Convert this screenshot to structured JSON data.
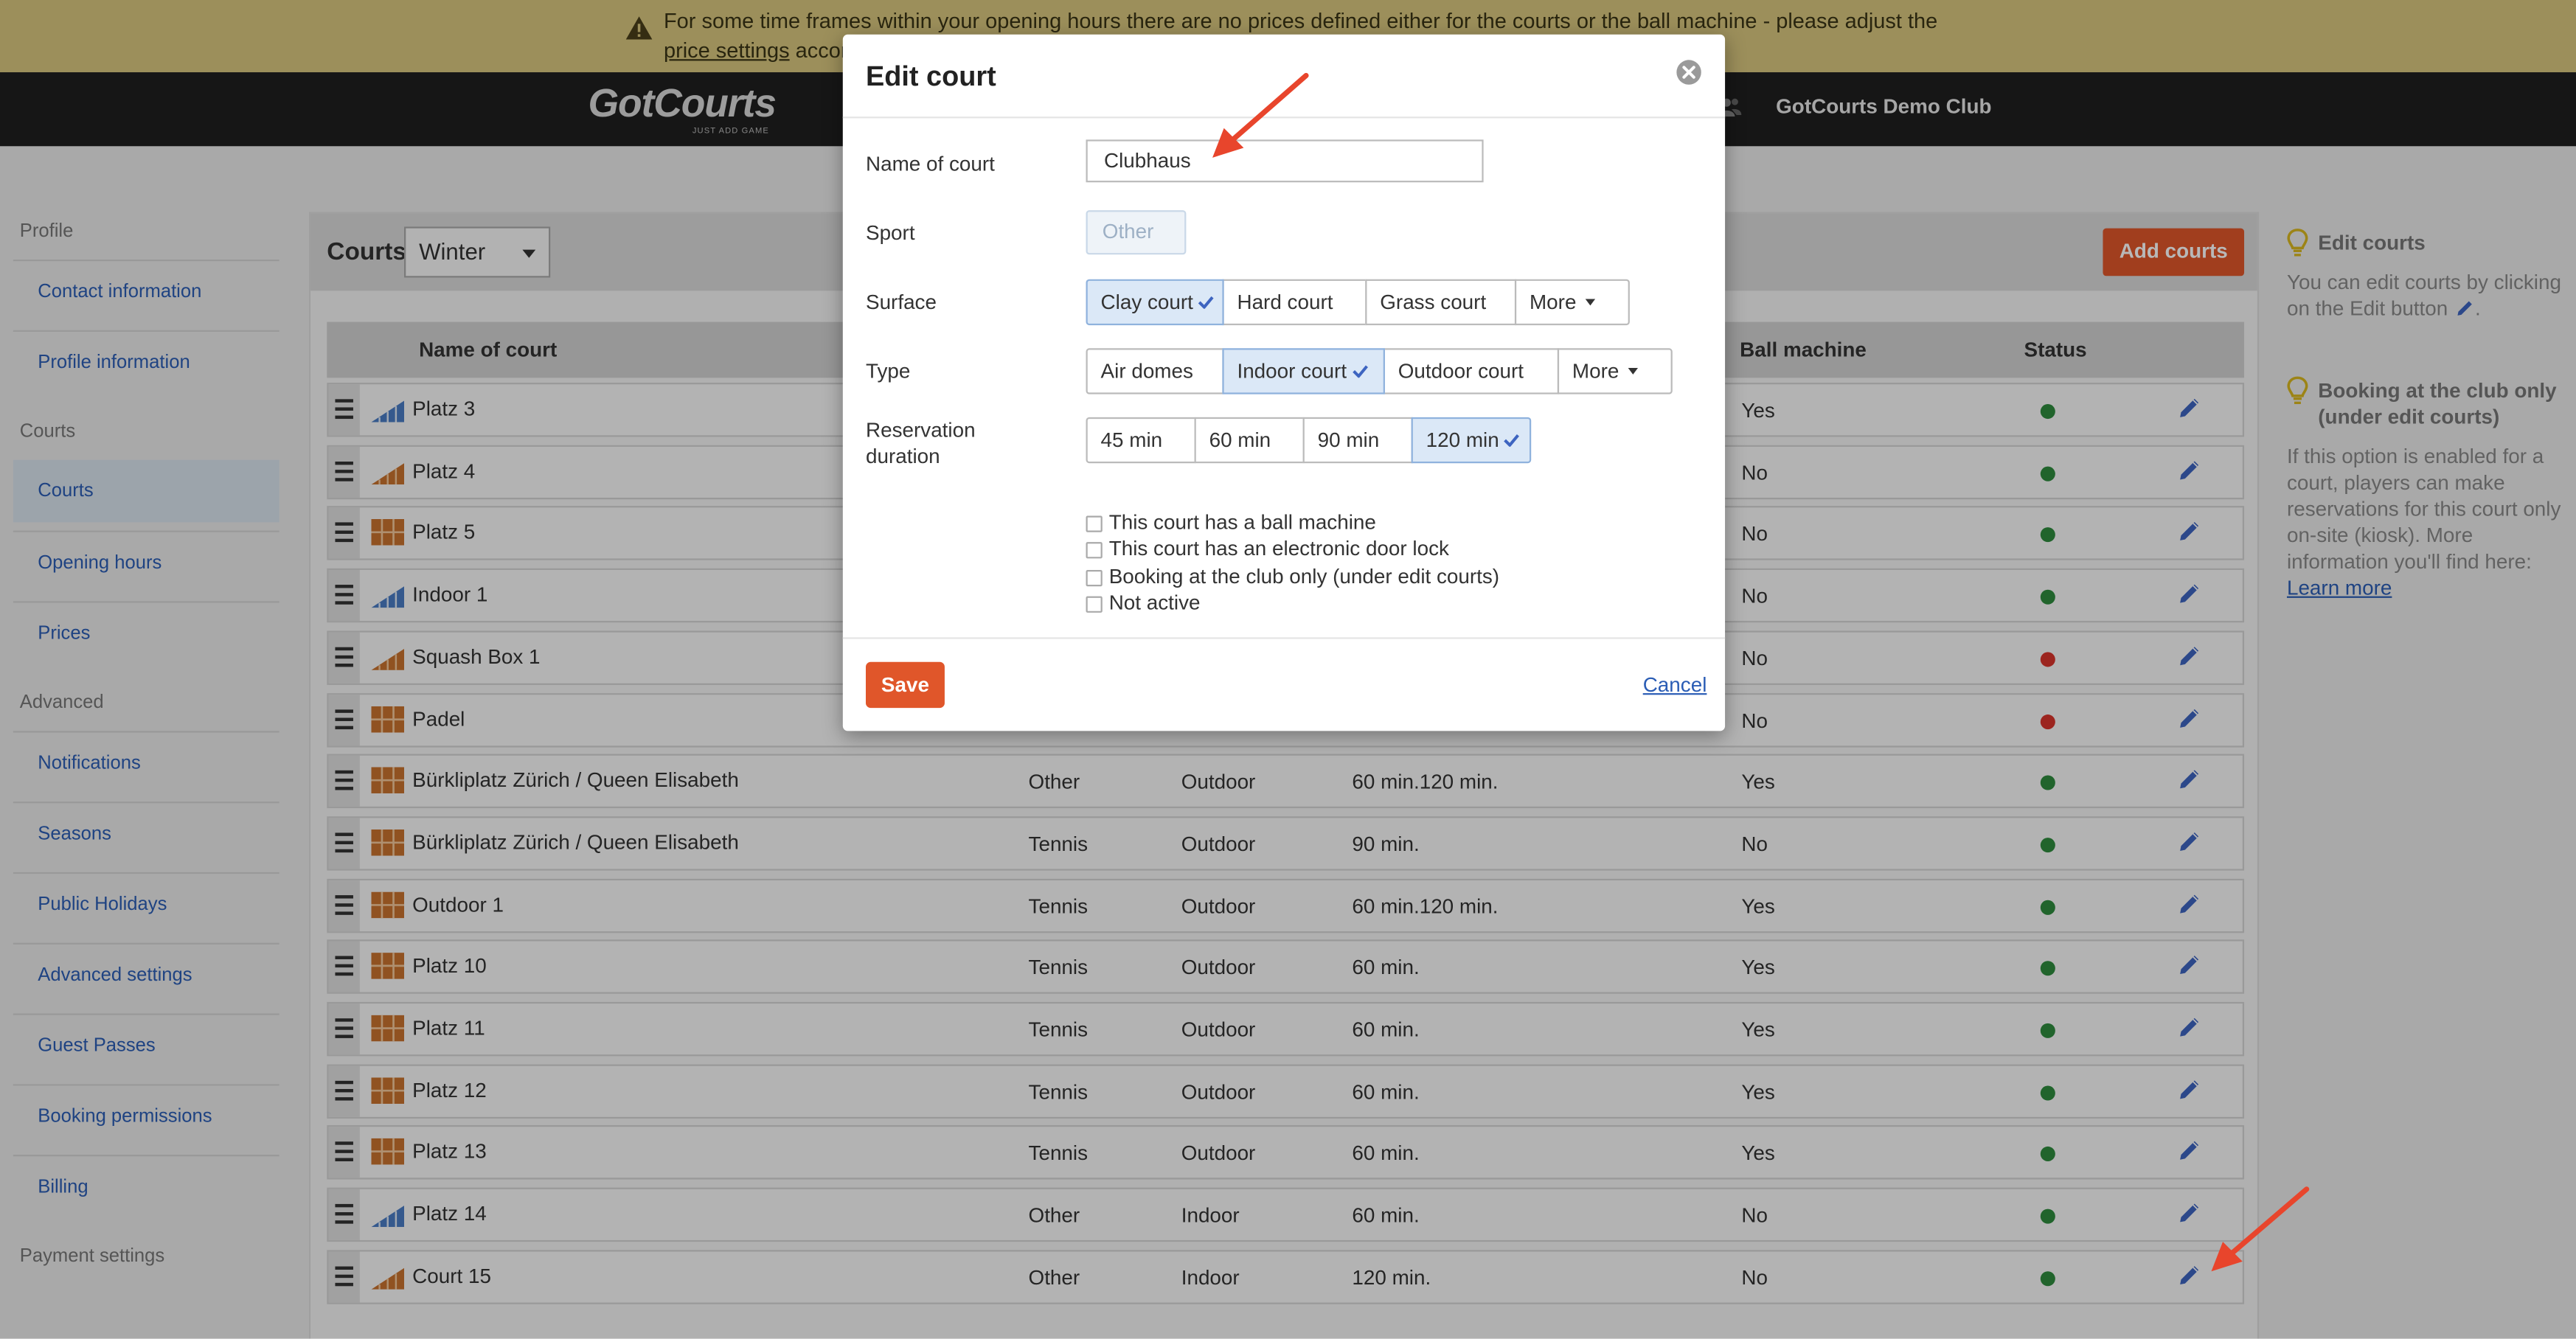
{
  "banner": {
    "text": "For some time frames within your opening hours there are no prices defined either for the courts or the ball machine - please adjust the ",
    "link": "price settings",
    "tail": " accordingly."
  },
  "nav": {
    "logo_main": "GotCourts",
    "logo_sub": "JUST ADD GAME",
    "club_name": "GotCourts Demo Club"
  },
  "sidebar": {
    "sections": [
      {
        "title": "Profile",
        "items": [
          "Contact information",
          "Profile information"
        ]
      },
      {
        "title": "Courts",
        "items": [
          "Courts",
          "Opening hours",
          "Prices"
        ]
      },
      {
        "title": "Advanced",
        "items": [
          "Notifications",
          "Seasons",
          "Public Holidays",
          "Advanced settings",
          "Guest Passes",
          "Booking permissions",
          "Billing"
        ]
      },
      {
        "title": "Payment settings",
        "items": []
      }
    ],
    "active": "Courts"
  },
  "courts_panel": {
    "title": "Courts",
    "season": "Winter",
    "add_button": "Add courts",
    "columns": {
      "name": "Name of court",
      "ball_machine": "Ball machine",
      "status": "Status"
    },
    "rows": [
      {
        "name": "Platz 3",
        "sport": "",
        "type": "",
        "duration": "",
        "ball": "Yes",
        "status": "active",
        "icon": "indoor"
      },
      {
        "name": "Platz 4",
        "sport": "",
        "type": "",
        "duration": "",
        "ball": "No",
        "status": "active",
        "icon": "stairs"
      },
      {
        "name": "Platz 5",
        "sport": "",
        "type": "",
        "duration": "",
        "ball": "No",
        "status": "active",
        "icon": "outdoor"
      },
      {
        "name": "Indoor 1",
        "sport": "",
        "type": "",
        "duration": "",
        "ball": "No",
        "status": "active",
        "icon": "indoor"
      },
      {
        "name": "Squash Box 1",
        "sport": "",
        "type": "",
        "duration": "",
        "ball": "No",
        "status": "inactive",
        "icon": "stairs"
      },
      {
        "name": "Padel",
        "sport": "",
        "type": "",
        "duration": "",
        "ball": "No",
        "status": "inactive",
        "icon": "outdoor"
      },
      {
        "name": "Bürkliplatz Zürich / Queen Elisabeth",
        "sport": "Other",
        "type": "Outdoor",
        "duration": "60 min.120 min.",
        "ball": "Yes",
        "status": "active",
        "icon": "outdoor"
      },
      {
        "name": "Bürkliplatz Zürich / Queen Elisabeth",
        "sport": "Tennis",
        "type": "Outdoor",
        "duration": "90 min.",
        "ball": "No",
        "status": "active",
        "icon": "outdoor"
      },
      {
        "name": "Outdoor 1",
        "sport": "Tennis",
        "type": "Outdoor",
        "duration": "60 min.120 min.",
        "ball": "Yes",
        "status": "active",
        "icon": "outdoor"
      },
      {
        "name": "Platz 10",
        "sport": "Tennis",
        "type": "Outdoor",
        "duration": "60 min.",
        "ball": "Yes",
        "status": "active",
        "icon": "outdoor"
      },
      {
        "name": "Platz 11",
        "sport": "Tennis",
        "type": "Outdoor",
        "duration": "60 min.",
        "ball": "Yes",
        "status": "active",
        "icon": "outdoor"
      },
      {
        "name": "Platz 12",
        "sport": "Tennis",
        "type": "Outdoor",
        "duration": "60 min.",
        "ball": "Yes",
        "status": "active",
        "icon": "outdoor"
      },
      {
        "name": "Platz 13",
        "sport": "Tennis",
        "type": "Outdoor",
        "duration": "60 min.",
        "ball": "Yes",
        "status": "active",
        "icon": "outdoor"
      },
      {
        "name": "Platz 14",
        "sport": "Other",
        "type": "Indoor",
        "duration": "60 min.",
        "ball": "No",
        "status": "active",
        "icon": "indoor"
      },
      {
        "name": "Court 15",
        "sport": "Other",
        "type": "Indoor",
        "duration": "120 min.",
        "ball": "No",
        "status": "active",
        "icon": "stairs"
      }
    ]
  },
  "help": {
    "edit_title": "Edit courts",
    "edit_text": "You can edit courts by clicking on the Edit button",
    "booking_title": "Booking at the club only (under edit courts)",
    "booking_text": "If this option is enabled for a court, players can make reservations for this court only on-site (kiosk). More information you'll find here:",
    "learn_more": "Learn more"
  },
  "modal": {
    "title": "Edit court",
    "name_label": "Name of court",
    "name_value": "Clubhaus",
    "sport_label": "Sport",
    "sport_value": "Other",
    "surface_label": "Surface",
    "surface_options": [
      "Clay court",
      "Hard court",
      "Grass court",
      "More"
    ],
    "surface_selected": "Clay court",
    "type_label": "Type",
    "type_options": [
      "Air domes",
      "Indoor court",
      "Outdoor court",
      "More"
    ],
    "type_selected": "Indoor court",
    "duration_label": "Reservation duration",
    "duration_options": [
      "45 min",
      "60 min",
      "90 min",
      "120 min"
    ],
    "duration_selected": "120 min",
    "checkboxes": [
      "This court has a ball machine",
      "This court has an electronic door lock",
      "Booking at the club only (under edit courts)",
      "Not active"
    ],
    "save": "Save",
    "cancel": "Cancel"
  },
  "colors": {
    "accent": "#e0562a",
    "link": "#2b5db5",
    "status_active": "#2e8b3e",
    "status_inactive": "#d9342b",
    "selected_bg": "#dbe8f7",
    "arrow": "#e8452c"
  }
}
